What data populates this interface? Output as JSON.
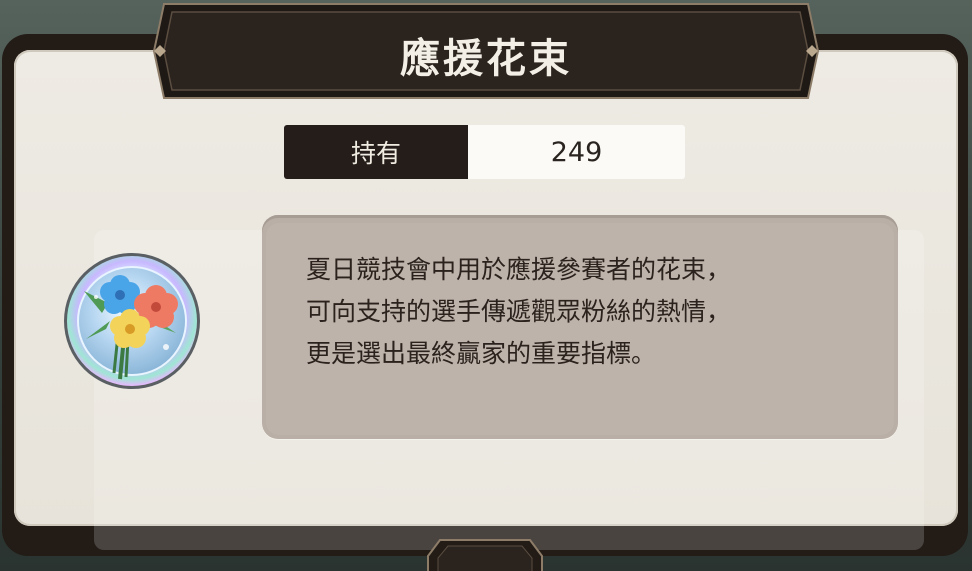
{
  "dialog": {
    "title": "應援花束",
    "holding_label": "持有",
    "holding_value": "249",
    "item_icon": "flower-bouquet-medal-icon",
    "description_lines": [
      "夏日競技會中用於應援參賽者的花束，",
      "可向支持的選手傳遞觀眾粉絲的熱情，",
      "更是選出最終贏家的重要指標。"
    ]
  },
  "colors": {
    "frame": "#221b16",
    "panel": "#eeebe4",
    "title_banner": "#2a221d",
    "title_text": "#f3efe6",
    "label_bg": "#241d19",
    "value_bg": "#fbfaf6",
    "description_bg": "#bdb3aa"
  }
}
